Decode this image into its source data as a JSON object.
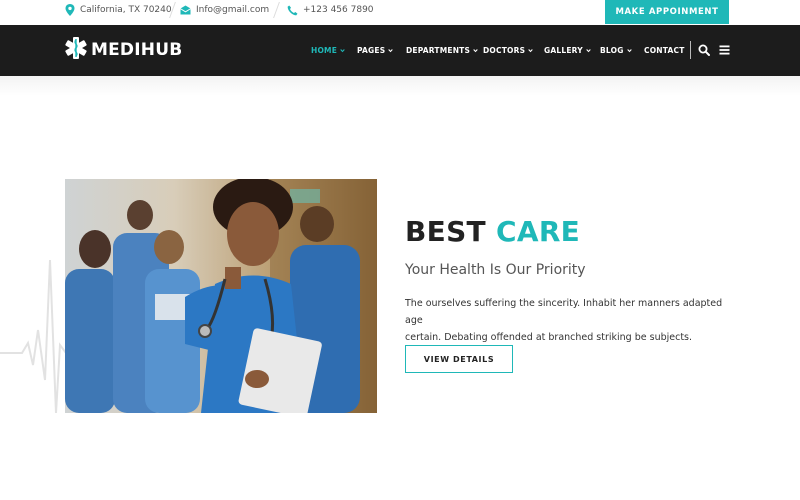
{
  "topbar": {
    "address": "California, TX 70240",
    "email": "Info@gmail.com",
    "phone": "+123 456 7890",
    "appointment_label": "MAKE APPOINMENT"
  },
  "brand": {
    "name": "MEDIHUB"
  },
  "nav": {
    "items": [
      {
        "label": "HOME",
        "active": true,
        "has_dropdown": true
      },
      {
        "label": "PAGES",
        "active": false,
        "has_dropdown": true
      },
      {
        "label": "DEPARTMENTS",
        "active": false,
        "has_dropdown": true
      },
      {
        "label": "DOCTORS",
        "active": false,
        "has_dropdown": true
      },
      {
        "label": "GALLERY",
        "active": false,
        "has_dropdown": true
      },
      {
        "label": "BLOG",
        "active": false,
        "has_dropdown": true
      },
      {
        "label": "CONTACT",
        "active": false,
        "has_dropdown": false
      }
    ],
    "icons": [
      "search-icon",
      "menu-icon"
    ]
  },
  "hero": {
    "heading_part1": "BEST",
    "heading_part2": "CARE",
    "subheading": "Your Health Is Our Priority",
    "body_line1": "The ourselves suffering the sincerity. Inhabit her manners adapted age",
    "body_line2": "certain. Debating offended at branched striking be subjects.",
    "cta_label": "VIEW DETAILS"
  },
  "colors": {
    "accent": "#1fb8b8",
    "nav_bg": "#1c1c1c",
    "text_dark": "#222222"
  }
}
